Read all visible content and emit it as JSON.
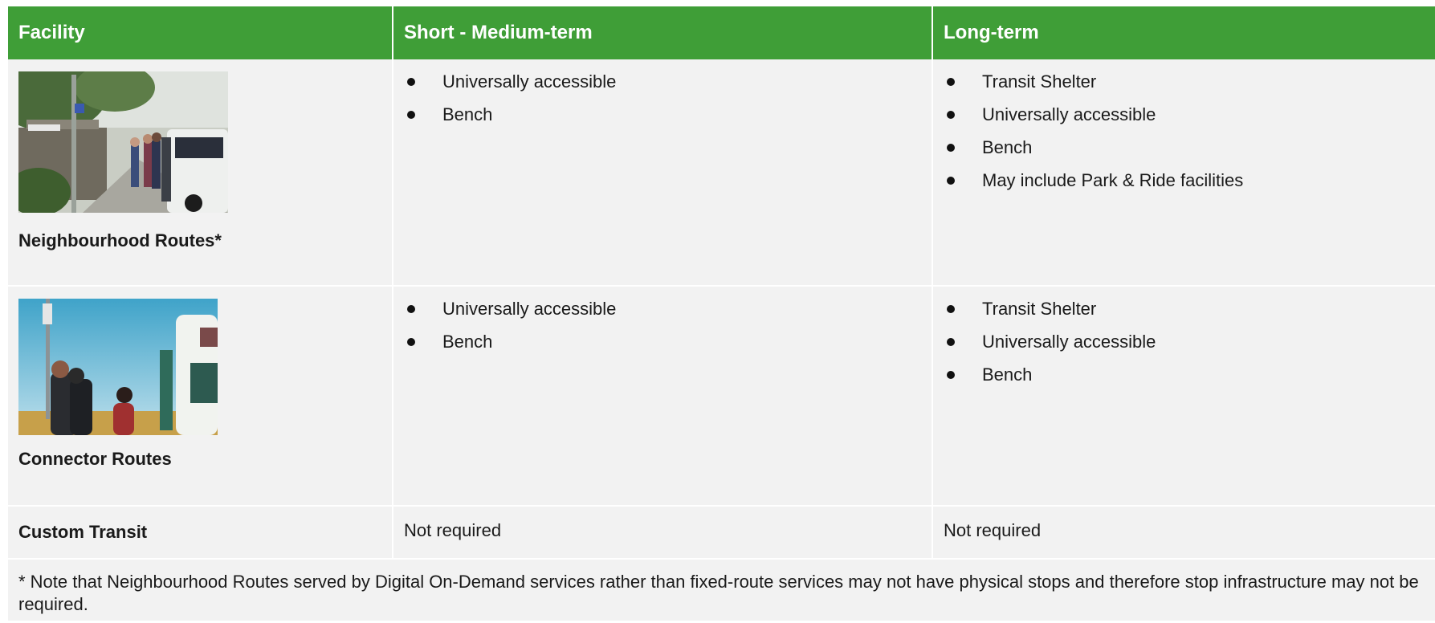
{
  "table": {
    "headers": {
      "facility": "Facility",
      "short_medium": "Short - Medium-term",
      "long": "Long-term"
    },
    "rows": [
      {
        "facility": "Neighbourhood Routes*",
        "photo": "bus-stop-photo",
        "short_medium": [
          "Universally accessible",
          "Bench"
        ],
        "long": [
          "Transit Shelter",
          "Universally accessible",
          "Bench",
          "May include Park & Ride facilities"
        ]
      },
      {
        "facility": "Connector Routes",
        "photo": "passengers-at-bus-photo",
        "short_medium": [
          "Universally accessible",
          "Bench"
        ],
        "long": [
          "Transit Shelter",
          "Universally accessible",
          "Bench"
        ]
      },
      {
        "facility": "Custom Transit",
        "short_medium_text": "Not required",
        "long_text": "Not required"
      }
    ],
    "note": "* Note that Neighbourhood Routes served by Digital On-Demand services rather than fixed-route services may not have physical stops and therefore stop infrastructure may not be required."
  },
  "colors": {
    "header_green": "#3f9e37",
    "cell_grey": "#f2f2f2"
  }
}
